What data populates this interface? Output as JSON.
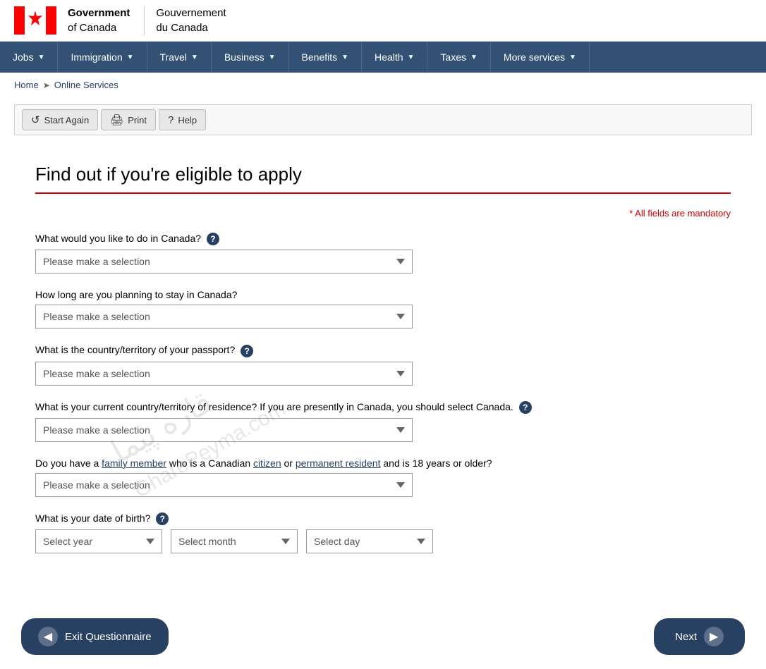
{
  "header": {
    "gov_name_en": "Government\nof Canada",
    "gov_name_fr": "Gouvernement\ndu Canada"
  },
  "nav": {
    "items": [
      {
        "label": "Jobs",
        "id": "jobs"
      },
      {
        "label": "Immigration",
        "id": "immigration"
      },
      {
        "label": "Travel",
        "id": "travel"
      },
      {
        "label": "Business",
        "id": "business"
      },
      {
        "label": "Benefits",
        "id": "benefits"
      },
      {
        "label": "Health",
        "id": "health"
      },
      {
        "label": "Taxes",
        "id": "taxes"
      },
      {
        "label": "More services",
        "id": "more-services"
      }
    ]
  },
  "breadcrumb": {
    "home_label": "Home",
    "section_label": "Online Services"
  },
  "toolbar": {
    "start_again_label": "Start Again",
    "print_label": "Print",
    "help_label": "Help"
  },
  "page": {
    "title": "Find out if you're eligible to apply",
    "mandatory_note": "* All fields are mandatory"
  },
  "form": {
    "q1_label": "What would you like to do in Canada?",
    "q1_placeholder": "Please make a selection",
    "q2_label": "How long are you planning to stay in Canada?",
    "q2_placeholder": "Please make a selection",
    "q3_label": "What is the country/territory of your passport?",
    "q3_placeholder": "Please make a selection",
    "q4_label": "What is your current country/territory of residence? If you are presently in Canada, you should select Canada.",
    "q4_placeholder": "Please make a selection",
    "q5_label_pre": "Do you have a ",
    "q5_family_member": "family member",
    "q5_label_mid": " who is a Canadian ",
    "q5_citizen": "citizen",
    "q5_label_mid2": " or ",
    "q5_permanent_resident": "permanent resident",
    "q5_label_post": " and is 18 years or older?",
    "q5_placeholder": "Please make a selection",
    "q6_label": "What is your date of birth?",
    "dob_year_placeholder": "Select year",
    "dob_month_placeholder": "Select month",
    "dob_day_placeholder": "Select day"
  },
  "buttons": {
    "exit_label": "Exit Questionnaire",
    "next_label": "Next"
  },
  "watermark": "قاره پیما\nGharePeyma.com"
}
